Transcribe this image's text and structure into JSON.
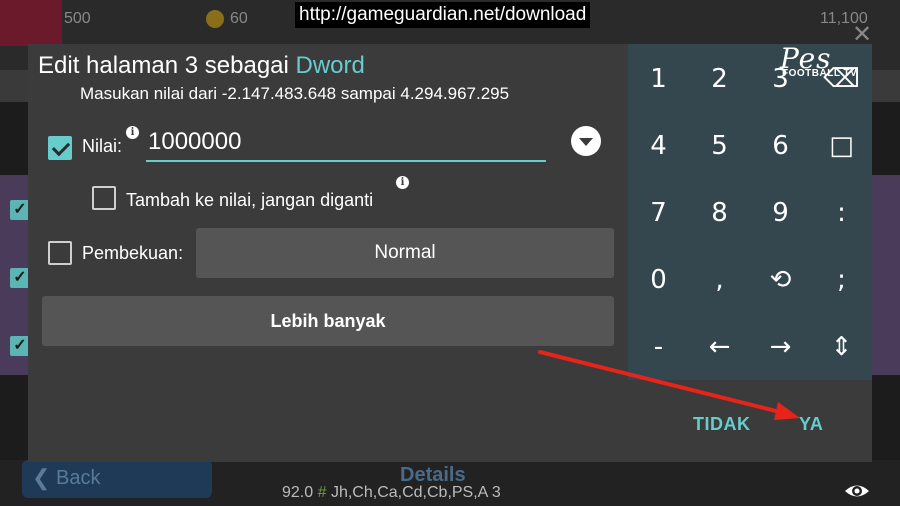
{
  "overlay": {
    "url": "http://gameguardian.net/download",
    "logo_main": "Pes",
    "logo_sub": "FOOTBALL TV"
  },
  "background": {
    "coins": "500",
    "gold": "60",
    "right_count": "11,100",
    "back_label": "Back",
    "details_label": "Details",
    "footer_prefix": "92.0 ",
    "footer_hash": "#",
    "footer_rest": " Jh,Ch,Ca,Cd,Cb,PS,A 3"
  },
  "dialog": {
    "title_prefix": "Edit halaman 3 sebagai ",
    "title_type": "Dword",
    "range_hint": "Masukan nilai dari -2.147.483.648 sampai 4.294.967.295",
    "value_label": "Nilai:",
    "value": "1000000",
    "value_checked": true,
    "add_label": "Tambah ke nilai, jangan diganti",
    "add_checked": false,
    "freeze_label": "Pembekuan:",
    "freeze_checked": false,
    "freeze_mode": "Normal",
    "more_label": "Lebih banyak",
    "no_label": "TIDAK",
    "yes_label": "YA"
  },
  "keypad": {
    "keys": [
      "1",
      "2",
      "3",
      "⌫",
      "4",
      "5",
      "6",
      "□",
      "7",
      "8",
      "9",
      ":",
      "0",
      ",",
      "⟲",
      ";",
      "-",
      "←",
      "→",
      "⇕"
    ]
  },
  "icons": {
    "info": "i",
    "check": "✓",
    "back_chevron": "❮",
    "close": "✕"
  },
  "colors": {
    "accent": "#66cccc",
    "dialog_bg": "#3b3b3b",
    "keypad_bg": "#34474f",
    "arrow": "#e8231a"
  }
}
